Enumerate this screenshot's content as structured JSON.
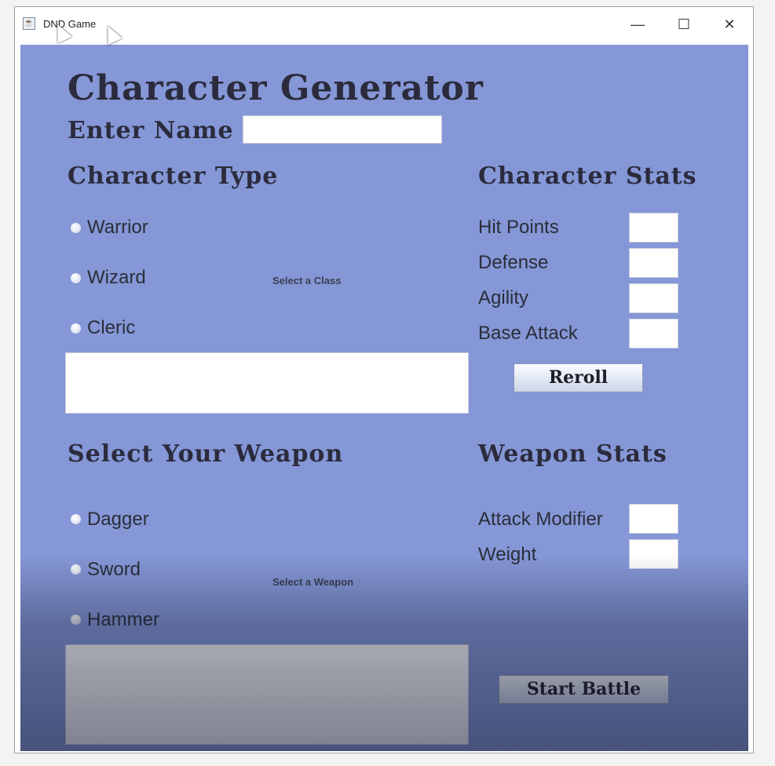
{
  "window": {
    "title": "DND Game",
    "minimize_glyph": "—",
    "maximize_glyph": "☐",
    "close_glyph": "✕"
  },
  "header": {
    "title": "Character Generator",
    "name_label": "Enter Name",
    "name_value": ""
  },
  "character_type": {
    "heading": "Character Type",
    "options": [
      "Warrior",
      "Wizard",
      "Cleric"
    ],
    "status": "Select a Class",
    "description": ""
  },
  "character_stats": {
    "heading": "Character Stats",
    "rows": [
      {
        "label": "Hit Points",
        "value": ""
      },
      {
        "label": "Defense",
        "value": ""
      },
      {
        "label": "Agility",
        "value": ""
      },
      {
        "label": "Base Attack",
        "value": ""
      }
    ],
    "reroll_label": "Reroll"
  },
  "weapon": {
    "heading": "Select Your Weapon",
    "options": [
      "Dagger",
      "Sword",
      "Hammer"
    ],
    "status": "Select a Weapon",
    "description": ""
  },
  "weapon_stats": {
    "heading": "Weapon Stats",
    "rows": [
      {
        "label": "Attack Modifier",
        "value": ""
      },
      {
        "label": "Weight",
        "value": ""
      }
    ]
  },
  "start_battle_label": "Start Battle",
  "colors": {
    "panel_bg": "#8597d6",
    "heading_text": "#2b2b3d"
  },
  "icons": {
    "app": "java-app-icon"
  }
}
